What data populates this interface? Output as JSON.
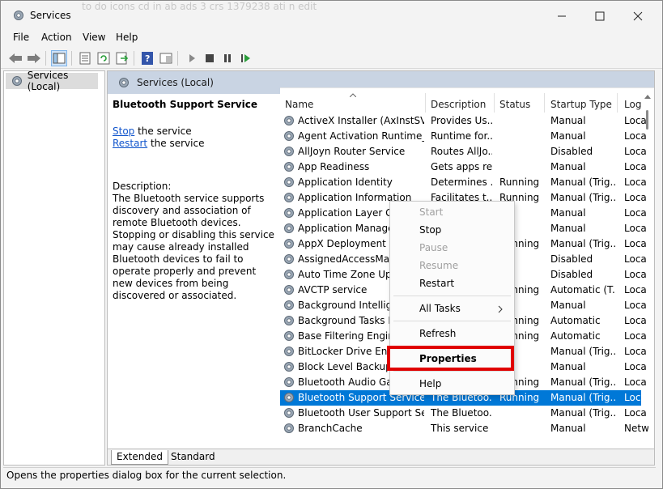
{
  "window": {
    "title": "Services",
    "ghost_text": "to do icons cd in ab ads 3 crs 1379238 ati n edit"
  },
  "menu": [
    "File",
    "Action",
    "View",
    "Help"
  ],
  "toolbar_icons": [
    "back-icon",
    "forward-icon",
    "show-tree-icon",
    "properties-icon",
    "refresh-icon",
    "export-icon",
    "help-icon",
    "console-icon",
    "start-icon",
    "stop-icon",
    "pause-icon",
    "resume-icon"
  ],
  "tree": {
    "root_label": "Services (Local)"
  },
  "main": {
    "header_label": "Services (Local)",
    "service_name": "Bluetooth Support Service",
    "stop_link": "Stop",
    "stop_suffix": " the service",
    "restart_link": "Restart",
    "restart_suffix": " the service",
    "description_label": "Description:",
    "description": "The Bluetooth service supports discovery and association of remote Bluetooth devices.  Stopping or disabling this service may cause already installed Bluetooth devices to fail to operate properly and prevent new devices from being discovered or associated."
  },
  "columns": {
    "name": "Name",
    "description": "Description",
    "status": "Status",
    "startup": "Startup Type",
    "logon": "Log"
  },
  "rows": [
    {
      "name": "ActiveX Installer (AxInstSV)",
      "desc": "Provides Us...",
      "status": "",
      "startup": "Manual",
      "logon": "Loca"
    },
    {
      "name": "Agent Activation Runtime_...",
      "desc": "Runtime for...",
      "status": "",
      "startup": "Manual",
      "logon": "Loca"
    },
    {
      "name": "AllJoyn Router Service",
      "desc": "Routes AllJo...",
      "status": "",
      "startup": "Disabled",
      "logon": "Loca"
    },
    {
      "name": "App Readiness",
      "desc": "Gets apps re...",
      "status": "",
      "startup": "Manual",
      "logon": "Loca"
    },
    {
      "name": "Application Identity",
      "desc": "Determines ...",
      "status": "Running",
      "startup": "Manual (Trig...",
      "logon": "Loca"
    },
    {
      "name": "Application Information",
      "desc": "Facilitates t...",
      "status": "Running",
      "startup": "Manual (Trig...",
      "logon": "Loca"
    },
    {
      "name": "Application Layer Gat",
      "desc": "",
      "status": "",
      "startup": "Manual",
      "logon": "Loca"
    },
    {
      "name": "Application Manager",
      "desc": "",
      "status": "",
      "startup": "Manual",
      "logon": "Loca"
    },
    {
      "name": "AppX Deployment Se",
      "desc": "",
      "status": "Running",
      "startup": "Manual (Trig...",
      "logon": "Loca"
    },
    {
      "name": "AssignedAccessMana",
      "desc": "",
      "status": "",
      "startup": "Disabled",
      "logon": "Loca"
    },
    {
      "name": "Auto Time Zone Upda",
      "desc": "",
      "status": "",
      "startup": "Disabled",
      "logon": "Loca"
    },
    {
      "name": "AVCTP service",
      "desc": "",
      "status": "Running",
      "startup": "Automatic (T...",
      "logon": "Loca"
    },
    {
      "name": "Background Intellige",
      "desc": "",
      "status": "",
      "startup": "Manual",
      "logon": "Loca"
    },
    {
      "name": "Background Tasks Inf",
      "desc": "",
      "status": "Running",
      "startup": "Automatic",
      "logon": "Loca"
    },
    {
      "name": "Base Filtering Engine",
      "desc": "",
      "status": "Running",
      "startup": "Automatic",
      "logon": "Loca"
    },
    {
      "name": "BitLocker Drive Encry",
      "desc": "",
      "status": "",
      "startup": "Manual (Trig...",
      "logon": "Loca"
    },
    {
      "name": "Block Level Backup E",
      "desc": "",
      "status": "",
      "startup": "Manual",
      "logon": "Loca"
    },
    {
      "name": "Bluetooth Audio Gate",
      "desc": "",
      "status": "Running",
      "startup": "Manual (Trig...",
      "logon": "Loca"
    },
    {
      "name": "Bluetooth Support Service",
      "desc": "The Bluetoo...",
      "status": "Running",
      "startup": "Manual (Trig...",
      "logon": "Loca"
    },
    {
      "name": "Bluetooth User Support Ser...",
      "desc": "The Bluetoo...",
      "status": "",
      "startup": "Manual (Trig...",
      "logon": "Loca"
    },
    {
      "name": "BranchCache",
      "desc": "This service ...",
      "status": "",
      "startup": "Manual",
      "logon": "Netw"
    }
  ],
  "context_menu": {
    "start": "Start",
    "stop": "Stop",
    "pause": "Pause",
    "resume": "Resume",
    "restart": "Restart",
    "all_tasks": "All Tasks",
    "refresh": "Refresh",
    "properties": "Properties",
    "help": "Help"
  },
  "tabs": {
    "extended": "Extended",
    "standard": "Standard"
  },
  "status_text": "Opens the properties dialog box for the current selection.",
  "colors": {
    "selection": "#0078d7",
    "highlight_box": "#e00000",
    "header_band": "#c9d4e3"
  }
}
